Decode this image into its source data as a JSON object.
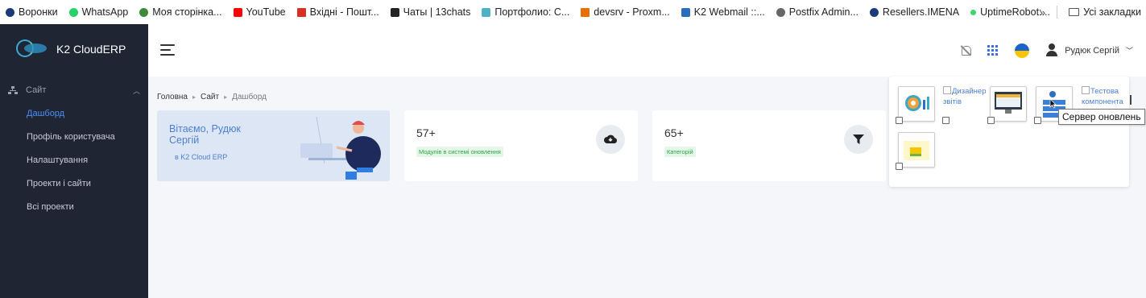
{
  "bookmarks": [
    {
      "label": "Воронки",
      "color": "#1a3a7a"
    },
    {
      "label": "WhatsApp",
      "color": "#25d366"
    },
    {
      "label": "Моя сторінка...",
      "color": "#3a8a3a"
    },
    {
      "label": "YouTube",
      "color": "#ff0000"
    },
    {
      "label": "Вхідні - Пошт...",
      "color": "#d93025"
    },
    {
      "label": "Чаты | 13chats",
      "color": "#222222"
    },
    {
      "label": "Портфолио: С...",
      "color": "#4fb0c6"
    },
    {
      "label": "devsrv - Proxm...",
      "color": "#e57000"
    },
    {
      "label": "K2 Webmail ::...",
      "color": "#2a6ebb"
    },
    {
      "label": "Postfix Admin...",
      "color": "#666666"
    },
    {
      "label": "Resellers.IMENA",
      "color": "#1a3a7a"
    },
    {
      "label": "UptimeRobot:...",
      "color": "#3bd671"
    }
  ],
  "bookmarks_more": "»",
  "bookmarks_folder": "Усі закладки",
  "brand": {
    "name": "K2 CloudERP"
  },
  "sidebar": {
    "section": "Сайт",
    "items": [
      {
        "label": "Дашборд",
        "active": true
      },
      {
        "label": "Профіль користувача",
        "active": false
      },
      {
        "label": "Налаштування",
        "active": false
      },
      {
        "label": "Проекти і сайти",
        "active": false
      },
      {
        "label": "Всі проекти",
        "active": false
      }
    ]
  },
  "topbar": {
    "user_name": "Рудюк Сергій"
  },
  "breadcrumb": [
    "Головна",
    "Сайт",
    "Дашборд"
  ],
  "welcome": {
    "title": "Вітаємо, Рудюк Сергій",
    "subtitle": "в K2 Cloud ERP"
  },
  "stats": [
    {
      "value": "57+",
      "badge": "Модулів в системі оновлення",
      "icon": "cloud-download-icon"
    },
    {
      "value": "65+",
      "badge": "Категорій",
      "icon": "filter-icon"
    }
  ],
  "popup": {
    "report_designer": "Дизайнер звітів",
    "test_component": "Тестова компонента"
  },
  "tooltip": "Сервер оновлень",
  "colors": {
    "sidebar_bg": "#1f2533",
    "accent": "#4c8ef7",
    "badge_green": "#27a844"
  }
}
